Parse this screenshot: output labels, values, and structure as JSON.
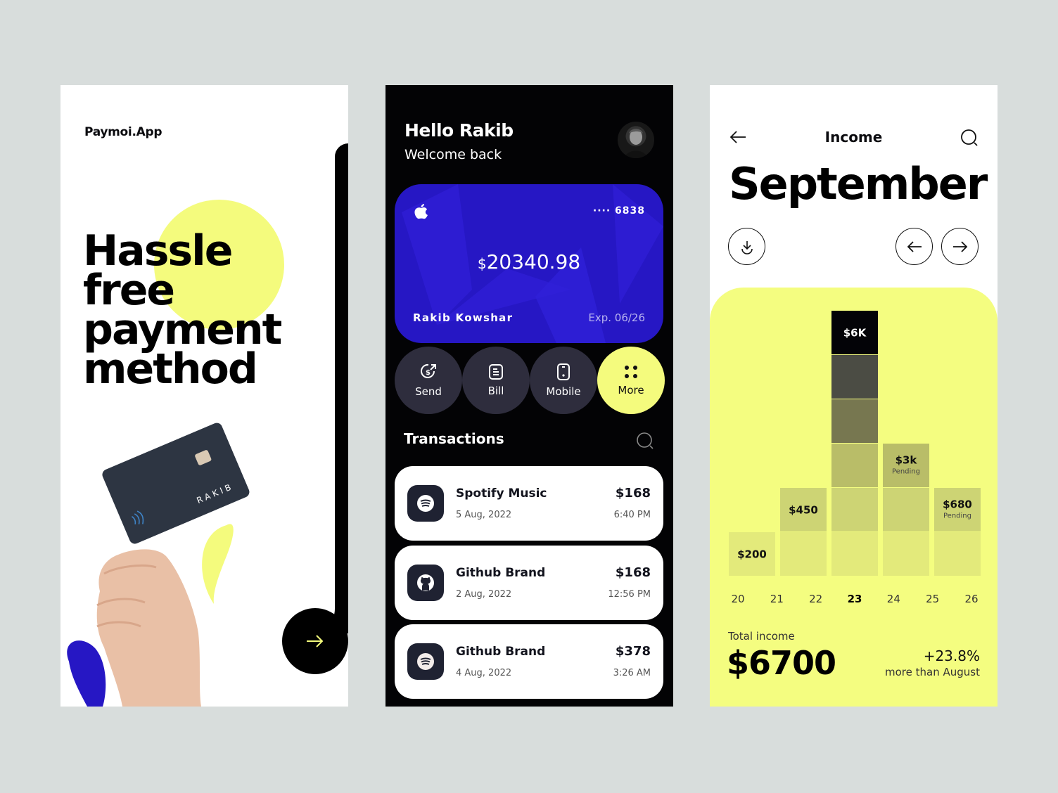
{
  "onboarding": {
    "brand": "Paymoi.App",
    "headline": [
      "Hassle",
      "free",
      "payment",
      "method"
    ],
    "card_name": "RAKIB",
    "next_icon": "arrow-right-icon",
    "colors": {
      "accent_yellow": "#f4fb7d",
      "accent_blue": "#2617c4",
      "dark": "#000000"
    }
  },
  "home": {
    "greeting": "Hello Rakib",
    "subtitle": "Welcome back",
    "card": {
      "brand_icon": "apple-icon",
      "number_masked": "···· 6838",
      "currency": "$",
      "balance": "20340.98",
      "holder": "Rakib Kowshar",
      "expiry": "Exp. 06/26"
    },
    "actions": [
      {
        "label": "Send",
        "icon": "send-money-icon"
      },
      {
        "label": "Bill",
        "icon": "bill-icon"
      },
      {
        "label": "Mobile",
        "icon": "mobile-icon"
      },
      {
        "label": "More",
        "icon": "more-grid-icon"
      }
    ],
    "transactions_title": "Transactions",
    "transactions": [
      {
        "name": "Spotify Music",
        "date": "5 Aug, 2022",
        "amount": "$168",
        "time": "6:40 PM",
        "icon": "spotify-icon"
      },
      {
        "name": "Github Brand",
        "date": "2 Aug, 2022",
        "amount": "$168",
        "time": "12:56 PM",
        "icon": "github-icon"
      },
      {
        "name": "Github Brand",
        "date": "4 Aug, 2022",
        "amount": "$378",
        "time": "3:26 AM",
        "icon": "spotify-icon"
      }
    ]
  },
  "income": {
    "title": "Income",
    "month": "September",
    "total_label": "Total income",
    "total_value": "$6700",
    "delta": "+23.8%",
    "delta_sub": "more than August"
  },
  "chart_data": {
    "type": "bar",
    "title": "Income",
    "x_ticks": [
      "20",
      "21",
      "22",
      "23",
      "24",
      "25",
      "26"
    ],
    "highlighted_tick": "23",
    "bars": [
      {
        "label": "$200",
        "value": 200,
        "levels": 1,
        "status": ""
      },
      {
        "label": "$450",
        "value": 450,
        "levels": 2,
        "status": ""
      },
      {
        "label": "$6K",
        "value": 6000,
        "levels": 6,
        "status": ""
      },
      {
        "label": "$3k",
        "value": 3000,
        "levels": 3,
        "status": "Pending"
      },
      {
        "label": "$680",
        "value": 680,
        "levels": 2,
        "status": "Pending"
      }
    ],
    "level_colors": [
      "#e3ea7b",
      "#cdd474",
      "#b9bd68",
      "#777750",
      "#4b4c44",
      "#030307"
    ],
    "background": "#f4fd80"
  }
}
